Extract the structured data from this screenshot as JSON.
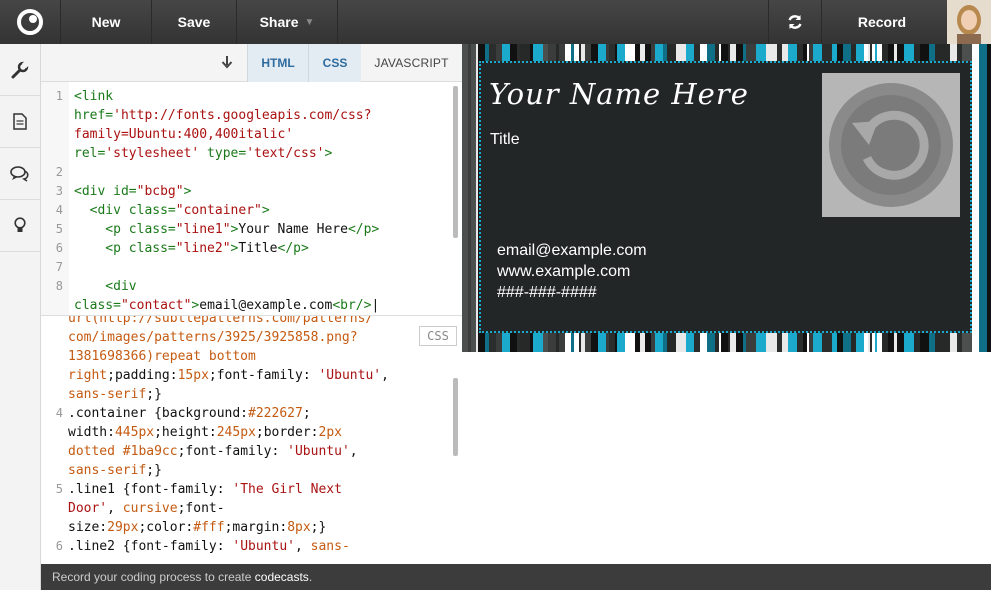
{
  "topbar": {
    "new_label": "New",
    "save_label": "Save",
    "share_label": "Share",
    "record_label": "Record"
  },
  "tabs": {
    "html": "HTML",
    "css": "CSS",
    "js": "JAVASCRIPT"
  },
  "html_code": {
    "lines": [
      {
        "num": "1",
        "parts": [
          {
            "c": "tag",
            "t": "<link"
          }
        ]
      },
      {
        "num": "",
        "parts": [
          {
            "c": "tag",
            "t": "href="
          },
          {
            "c": "str",
            "t": "'http://fonts.googleapis.com/css?"
          }
        ]
      },
      {
        "num": "",
        "parts": [
          {
            "c": "str",
            "t": "family=Ubuntu:400,400italic'"
          }
        ]
      },
      {
        "num": "",
        "parts": [
          {
            "c": "tag",
            "t": "rel="
          },
          {
            "c": "str",
            "t": "'stylesheet'"
          },
          {
            "c": "tag",
            "t": " type="
          },
          {
            "c": "str",
            "t": "'text/css'"
          },
          {
            "c": "tag",
            "t": ">"
          }
        ]
      },
      {
        "num": "2",
        "parts": []
      },
      {
        "num": "3",
        "parts": [
          {
            "c": "tag",
            "t": "<div id="
          },
          {
            "c": "str",
            "t": "\"bcbg\""
          },
          {
            "c": "tag",
            "t": ">"
          }
        ]
      },
      {
        "num": "4",
        "parts": [
          {
            "c": "tag",
            "t": "  <div class="
          },
          {
            "c": "str",
            "t": "\"container\""
          },
          {
            "c": "tag",
            "t": ">"
          }
        ]
      },
      {
        "num": "5",
        "parts": [
          {
            "c": "tag",
            "t": "    <p class="
          },
          {
            "c": "str",
            "t": "\"line1\""
          },
          {
            "c": "tag",
            "t": ">"
          },
          {
            "c": "txt",
            "t": "Your Name Here"
          },
          {
            "c": "tag",
            "t": "</p>"
          }
        ]
      },
      {
        "num": "6",
        "parts": [
          {
            "c": "tag",
            "t": "    <p class="
          },
          {
            "c": "str",
            "t": "\"line2\""
          },
          {
            "c": "tag",
            "t": ">"
          },
          {
            "c": "txt",
            "t": "Title"
          },
          {
            "c": "tag",
            "t": "</p>"
          }
        ]
      },
      {
        "num": "7",
        "parts": []
      },
      {
        "num": "8",
        "parts": [
          {
            "c": "tag",
            "t": "    <div"
          }
        ]
      },
      {
        "num": "",
        "parts": [
          {
            "c": "tag",
            "t": "class="
          },
          {
            "c": "str",
            "t": "\"contact\""
          },
          {
            "c": "tag",
            "t": ">"
          },
          {
            "c": "txt",
            "t": "email@example.com"
          },
          {
            "c": "tag",
            "t": "<br/>"
          },
          {
            "c": "txt",
            "t": "|"
          }
        ]
      }
    ]
  },
  "css_badge": "CSS",
  "css_code": {
    "lines": [
      {
        "num": "",
        "parts": [
          {
            "c": "val",
            "t": "url(http://subtlepatterns.com/patterns/"
          }
        ]
      },
      {
        "num": "",
        "parts": [
          {
            "c": "val",
            "t": "com/images/patterns/3925/3925858.png?"
          }
        ]
      },
      {
        "num": "",
        "parts": [
          {
            "c": "val",
            "t": "1381698366)"
          },
          {
            "c": "val",
            "t": "repeat bottom"
          }
        ]
      },
      {
        "num": "",
        "parts": [
          {
            "c": "val",
            "t": "right"
          },
          {
            "c": "prop",
            "t": ";padding:"
          },
          {
            "c": "val",
            "t": "15px"
          },
          {
            "c": "prop",
            "t": ";font-family: "
          },
          {
            "c": "cstr",
            "t": "'Ubuntu'"
          },
          {
            "c": "prop",
            "t": ","
          }
        ]
      },
      {
        "num": "",
        "parts": [
          {
            "c": "val",
            "t": "sans-serif"
          },
          {
            "c": "prop",
            "t": ";}"
          }
        ]
      },
      {
        "num": "4",
        "parts": [
          {
            "c": "sel",
            "t": ".container {background:"
          },
          {
            "c": "val",
            "t": "#222627"
          },
          {
            "c": "prop",
            "t": ";"
          }
        ]
      },
      {
        "num": "",
        "parts": [
          {
            "c": "prop",
            "t": "width:"
          },
          {
            "c": "val",
            "t": "445px"
          },
          {
            "c": "prop",
            "t": ";height:"
          },
          {
            "c": "val",
            "t": "245px"
          },
          {
            "c": "prop",
            "t": ";border:"
          },
          {
            "c": "val",
            "t": "2px"
          }
        ]
      },
      {
        "num": "",
        "parts": [
          {
            "c": "val",
            "t": "dotted #1ba9cc"
          },
          {
            "c": "prop",
            "t": ";font-family: "
          },
          {
            "c": "cstr",
            "t": "'Ubuntu'"
          },
          {
            "c": "prop",
            "t": ","
          }
        ]
      },
      {
        "num": "",
        "parts": [
          {
            "c": "val",
            "t": "sans-serif"
          },
          {
            "c": "prop",
            "t": ";}"
          }
        ]
      },
      {
        "num": "5",
        "parts": [
          {
            "c": "sel",
            "t": ".line1 {font-family: "
          },
          {
            "c": "cstr",
            "t": "'The Girl Next"
          }
        ]
      },
      {
        "num": "",
        "parts": [
          {
            "c": "cstr",
            "t": "Door'"
          },
          {
            "c": "prop",
            "t": ", "
          },
          {
            "c": "val",
            "t": "cursive"
          },
          {
            "c": "prop",
            "t": ";font-"
          }
        ]
      },
      {
        "num": "",
        "parts": [
          {
            "c": "prop",
            "t": "size:"
          },
          {
            "c": "val",
            "t": "29px"
          },
          {
            "c": "prop",
            "t": ";color:"
          },
          {
            "c": "val",
            "t": "#fff"
          },
          {
            "c": "prop",
            "t": ";margin:"
          },
          {
            "c": "val",
            "t": "8px"
          },
          {
            "c": "prop",
            "t": ";}"
          }
        ]
      },
      {
        "num": "6",
        "parts": [
          {
            "c": "sel",
            "t": ".line2 {font-family: "
          },
          {
            "c": "cstr",
            "t": "'Ubuntu'"
          },
          {
            "c": "prop",
            "t": ", "
          },
          {
            "c": "val",
            "t": "sans-"
          }
        ]
      }
    ]
  },
  "preview": {
    "name": "Your Name Here",
    "title": "Title",
    "email": "email@example.com",
    "website": "www.example.com",
    "phone": "###-###-####",
    "accent_color": "#1ba9cc",
    "card_bg": "#222627"
  },
  "footer": {
    "prefix": "Record your coding process to create ",
    "highlight": "codecasts",
    "suffix": "."
  }
}
